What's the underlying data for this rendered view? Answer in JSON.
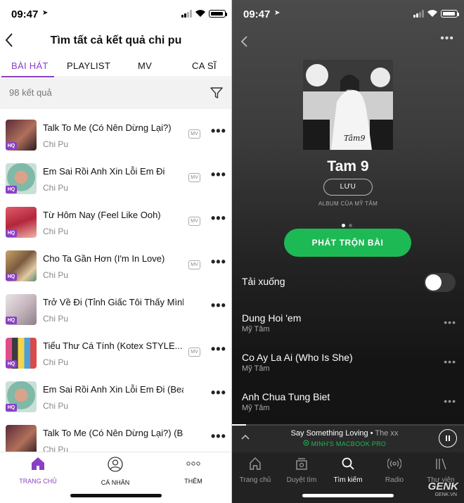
{
  "left": {
    "status_time": "09:47",
    "title": "Tìm tất cả kết quả chi pu",
    "tabs": [
      {
        "label": "BÀI HÁT",
        "active": true
      },
      {
        "label": "PLAYLIST",
        "active": false
      },
      {
        "label": "MV",
        "active": false
      },
      {
        "label": "CA SĨ",
        "active": false
      }
    ],
    "results_count": "98 kết quả",
    "hq_label": "HQ",
    "mv_label": "MV",
    "songs": [
      {
        "title": "Talk To Me (Có Nên Dừng Lại?)",
        "artist": "Chi Pu"
      },
      {
        "title": "Em Sai Rồi Anh Xin Lỗi Em Đi",
        "artist": "Chi Pu"
      },
      {
        "title": "Từ Hôm Nay (Feel Like Ooh)",
        "artist": "Chi Pu"
      },
      {
        "title": "Cho Ta Gần Hơn (I'm In Love)",
        "artist": "Chi Pu"
      },
      {
        "title": "Trở Về Đi (Tỉnh Giấc Tôi Thấy Mình Tr...",
        "artist": "Chi Pu"
      },
      {
        "title": "Tiểu Thư Cá Tính (Kotex STYLE...",
        "artist": "Chi Pu"
      },
      {
        "title": "Em Sai Rồi Anh Xin Lỗi Em Đi (Beat)",
        "artist": "Chi Pu"
      },
      {
        "title": "Talk To Me (Có Nên Dừng Lại?) (Beat)",
        "artist": "Chi Pu"
      }
    ],
    "tabbar": {
      "home": "TRANG CHỦ",
      "profile": "CÁ NHÂN",
      "more": "THÊM"
    },
    "accent_color": "#8a3fc4"
  },
  "right": {
    "status_time": "09:47",
    "album_title": "Tam 9",
    "save_label": "LƯU",
    "album_sub": "ALBUM CỦA MỸ TÂM",
    "shuffle_label": "PHÁT TRỘN BÀI",
    "download_label": "Tải xuống",
    "download_enabled": false,
    "tracks": [
      {
        "name": "Dung Hoi 'em",
        "artist": "Mỹ Tâm"
      },
      {
        "name": "Co Ay La Ai (Who Is She)",
        "artist": "Mỹ Tâm"
      },
      {
        "name": "Anh Chua Tung Biet",
        "artist": "Mỹ Tâm"
      }
    ],
    "now_playing": {
      "song": "Say Something Loving",
      "artist": "The xx",
      "device": "MINH'S MACBOOK PRO",
      "progress": 0.06
    },
    "tabbar": {
      "home": "Trang chủ",
      "browse": "Duyệt tìm",
      "search": "Tìm kiếm",
      "radio": "Radio",
      "library": "Thư viện"
    },
    "watermark": "GENK",
    "watermark_url": "GENK.VN",
    "accent_color": "#1db954"
  }
}
